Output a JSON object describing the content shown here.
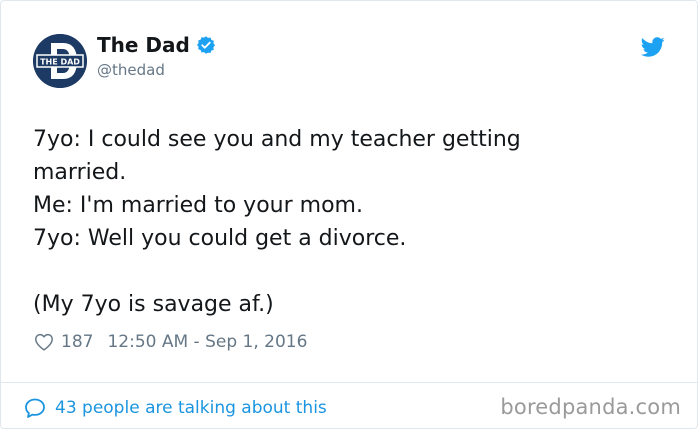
{
  "tweet": {
    "display_name": "The Dad",
    "handle": "@thedad",
    "avatar_text": "THE DAD",
    "text": "7yo: I could see you and my teacher getting\nmarried.\nMe: I'm married to your mom.\n7yo: Well you could get a divorce.\n\n(My 7yo is savage af.)",
    "likes": "187",
    "timestamp": "12:50 AM - Sep 1, 2016",
    "talking": "43 people are talking about this"
  },
  "watermark": "boredpanda.com",
  "colors": {
    "twitter_blue": "#1da1f2",
    "link_blue": "#1b95e0",
    "avatar_navy": "#1c3a63",
    "muted_text": "#657786"
  },
  "icons": {
    "verified": "verified-badge-icon",
    "brand": "twitter-bird-icon",
    "like": "heart-icon",
    "reply": "speech-bubble-icon"
  }
}
